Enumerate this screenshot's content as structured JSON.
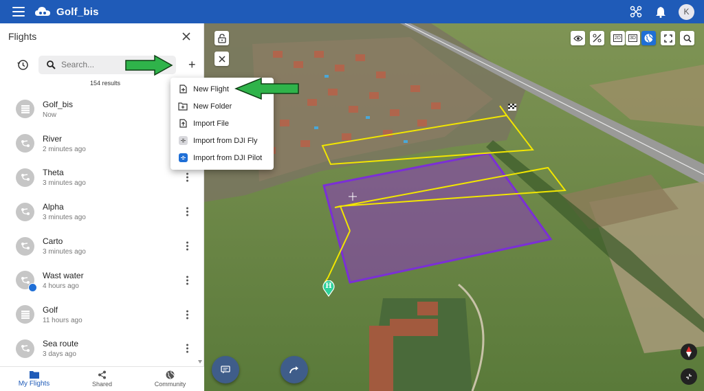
{
  "app": {
    "title": "Golf_bis",
    "user_initial": "K"
  },
  "panel": {
    "title": "Flights",
    "search_placeholder": "Search...",
    "results": "154 results",
    "flights": [
      {
        "name": "Golf_bis",
        "time": "Now",
        "icon": "grid-icon",
        "badge": false,
        "menu": false
      },
      {
        "name": "River",
        "time": "2 minutes ago",
        "icon": "path-icon",
        "badge": false,
        "menu": false
      },
      {
        "name": "Theta",
        "time": "3 minutes ago",
        "icon": "path-icon",
        "badge": false,
        "menu": true
      },
      {
        "name": "Alpha",
        "time": "3 minutes ago",
        "icon": "path-icon",
        "badge": false,
        "menu": true
      },
      {
        "name": "Carto",
        "time": "3 minutes ago",
        "icon": "path-icon",
        "badge": false,
        "menu": true
      },
      {
        "name": "Wast water",
        "time": "4 hours ago",
        "icon": "path-icon",
        "badge": true,
        "menu": true
      },
      {
        "name": "Golf",
        "time": "11 hours ago",
        "icon": "grid-icon",
        "badge": false,
        "menu": true
      },
      {
        "name": "Sea route",
        "time": "3 days ago",
        "icon": "path-icon",
        "badge": false,
        "menu": true
      }
    ]
  },
  "dropdown": {
    "items": [
      {
        "label": "New Flight",
        "icon": "new-flight-icon"
      },
      {
        "label": "New Folder",
        "icon": "new-folder-icon"
      },
      {
        "label": "Import File",
        "icon": "import-file-icon"
      },
      {
        "label": "Import from DJI Fly",
        "icon": "dji-fly-icon"
      },
      {
        "label": "Import from DJI Pilot",
        "icon": "dji-pilot-icon"
      }
    ]
  },
  "bottom_nav": {
    "my_flights": "My Flights",
    "shared": "Shared",
    "community": "Community"
  },
  "map": {
    "view_2d": "2D",
    "view_3d": "3D",
    "home_marker": "H"
  },
  "colors": {
    "topbar": "#1f5bb8",
    "accent": "#1f6fd6",
    "area_polygon": "#7b2fd6",
    "path_line": "#f2e600",
    "arrow": "#2fb34a"
  }
}
